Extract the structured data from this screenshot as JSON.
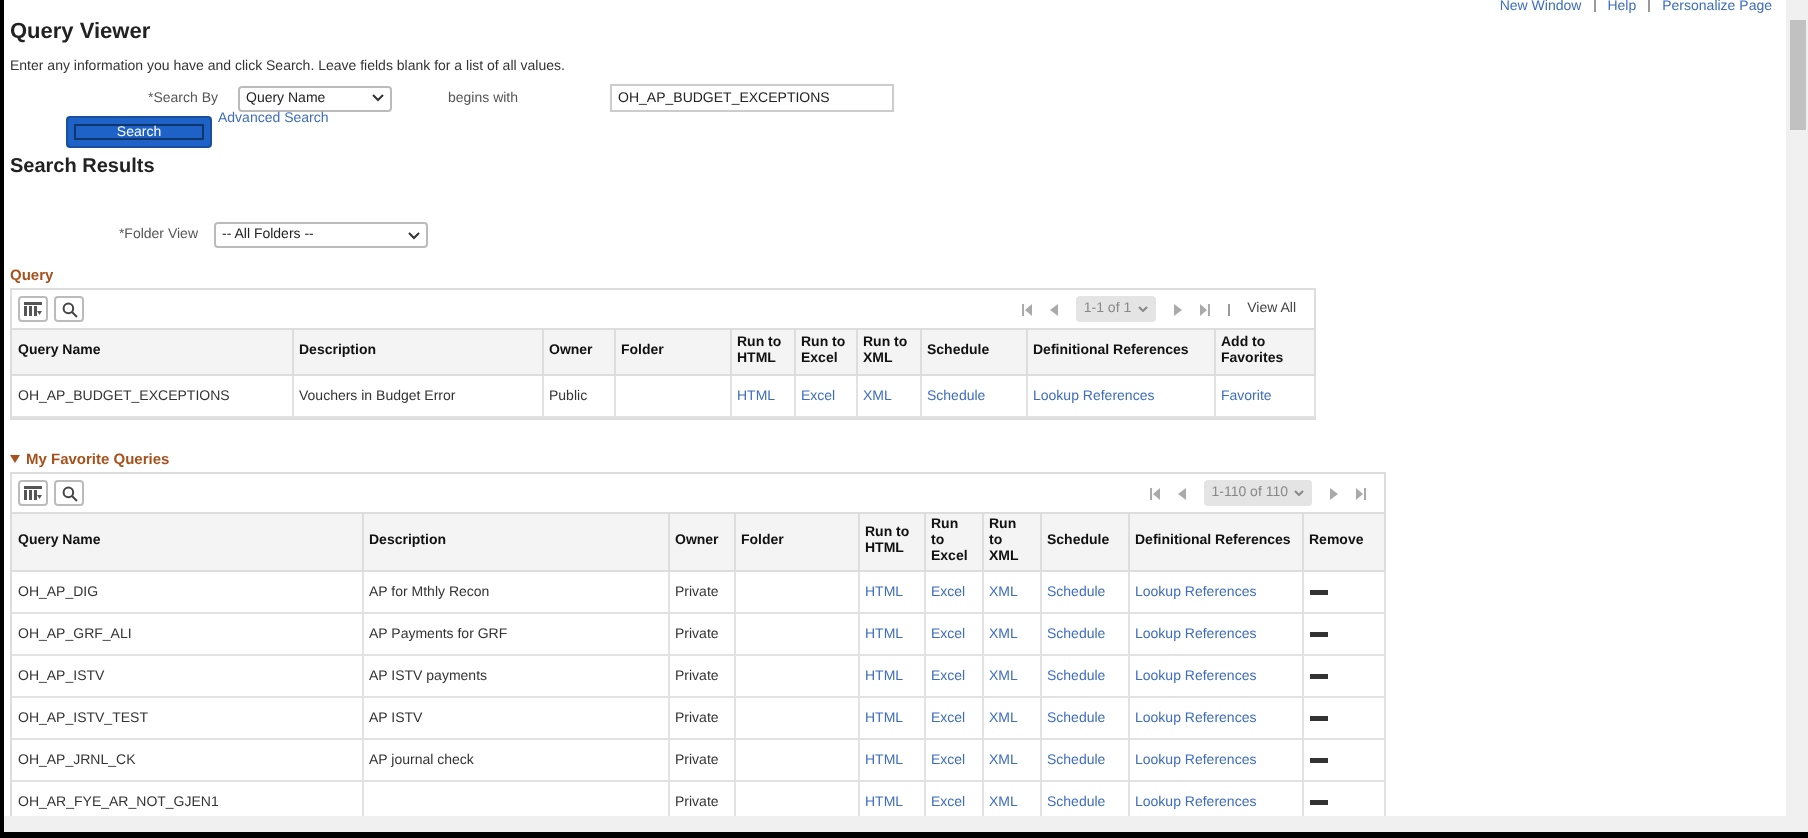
{
  "top_links": [
    "New Window",
    "Help",
    "Personalize Page"
  ],
  "title": "Query Viewer",
  "instructions": "Enter any information you have and click Search. Leave fields blank for a list of all values.",
  "search": {
    "label": "*Search By",
    "select_value": "Query Name",
    "operator": "begins with",
    "value": "OH_AP_BUDGET_EXCEPTIONS",
    "button": "Search",
    "advanced_link": "Advanced Search"
  },
  "results_title": "Search Results",
  "folder_view": {
    "label": "*Folder View",
    "value": "-- All Folders --"
  },
  "query_grid": {
    "title": "Query",
    "pager": "1-1 of 1",
    "view_all": "View All",
    "columns": [
      "Query Name",
      "Description",
      "Owner",
      "Folder",
      "Run to HTML",
      "Run to Excel",
      "Run to XML",
      "Schedule",
      "Definitional References",
      "Add to Favorites"
    ],
    "rows": [
      {
        "query_name": "OH_AP_BUDGET_EXCEPTIONS",
        "description": "Vouchers in Budget Error",
        "owner": "Public",
        "html": "HTML",
        "excel": "Excel",
        "xml": "XML",
        "schedule": "Schedule",
        "references": "Lookup References",
        "favorite": "Favorite"
      }
    ]
  },
  "favorites_grid": {
    "title": "My Favorite Queries",
    "expanded": true,
    "pager": "1-110 of 110",
    "columns": [
      "Query Name",
      "Description",
      "Owner",
      "Folder",
      "Run to HTML",
      "Run to Excel",
      "Run to XML",
      "Schedule",
      "Definitional References",
      "Remove"
    ],
    "rows": [
      {
        "query_name": "OH_AP_DIG",
        "description": "AP for Mthly Recon",
        "owner": "Private",
        "html": "HTML",
        "excel": "Excel",
        "xml": "XML",
        "schedule": "Schedule",
        "references": "Lookup References"
      },
      {
        "query_name": "OH_AP_GRF_ALI",
        "description": "AP Payments for GRF",
        "owner": "Private",
        "html": "HTML",
        "excel": "Excel",
        "xml": "XML",
        "schedule": "Schedule",
        "references": "Lookup References"
      },
      {
        "query_name": "OH_AP_ISTV",
        "description": "AP ISTV payments",
        "owner": "Private",
        "html": "HTML",
        "excel": "Excel",
        "xml": "XML",
        "schedule": "Schedule",
        "references": "Lookup References"
      },
      {
        "query_name": "OH_AP_ISTV_TEST",
        "description": "AP ISTV",
        "owner": "Private",
        "html": "HTML",
        "excel": "Excel",
        "xml": "XML",
        "schedule": "Schedule",
        "references": "Lookup References"
      },
      {
        "query_name": "OH_AP_JRNL_CK",
        "description": "AP journal check",
        "owner": "Private",
        "html": "HTML",
        "excel": "Excel",
        "xml": "XML",
        "schedule": "Schedule",
        "references": "Lookup References"
      },
      {
        "query_name": "OH_AR_FYE_AR_NOT_GJEN1",
        "owner": "Private",
        "html": "HTML",
        "excel": "Excel",
        "xml": "XML",
        "schedule": "Schedule",
        "references": "Lookup References"
      }
    ]
  }
}
